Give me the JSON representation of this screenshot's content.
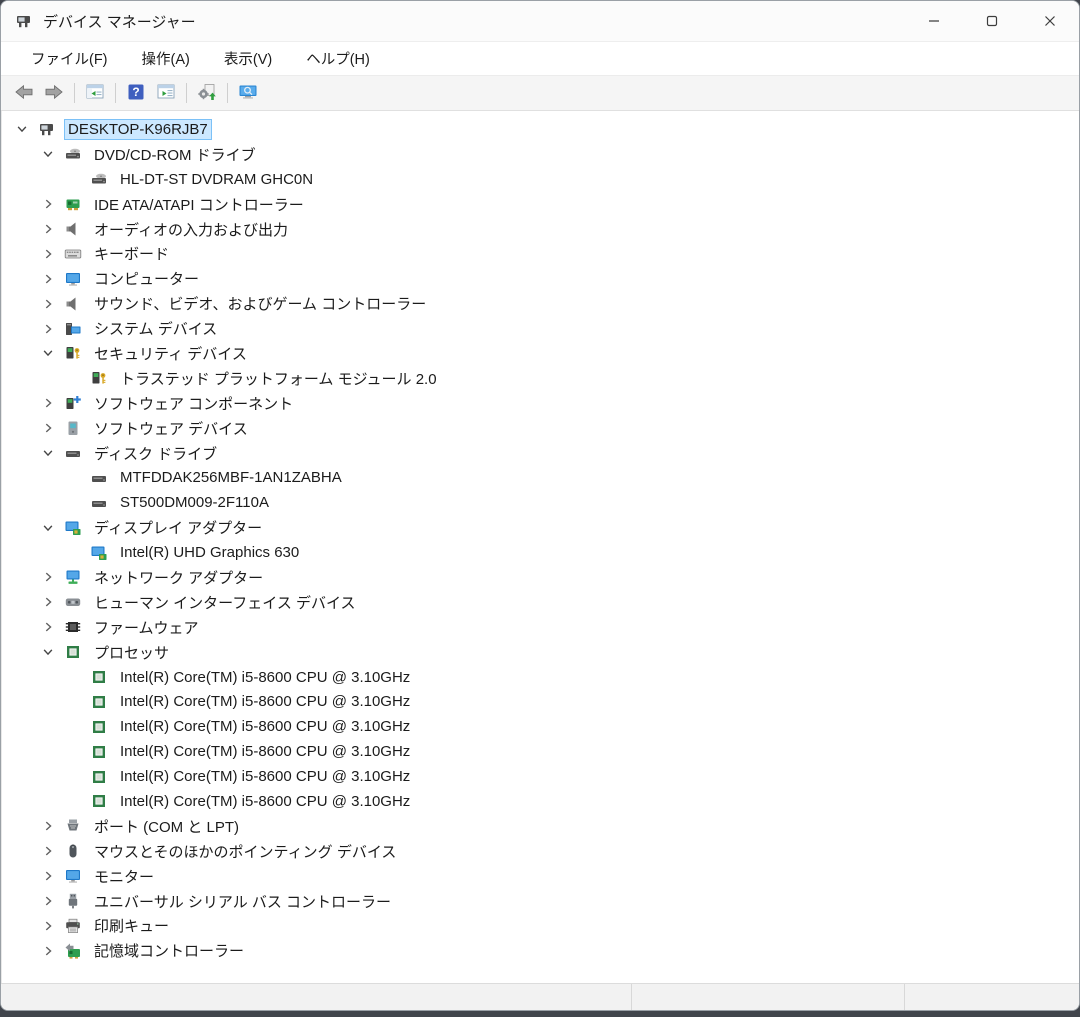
{
  "window": {
    "title": "デバイス マネージャー",
    "app_icon": "device-manager"
  },
  "menu": {
    "items": [
      {
        "label": "ファイル(F)"
      },
      {
        "label": "操作(A)"
      },
      {
        "label": "表示(V)"
      },
      {
        "label": "ヘルプ(H)"
      }
    ]
  },
  "toolbar": {
    "buttons": [
      {
        "name": "back",
        "icon": "nav-back"
      },
      {
        "name": "forward",
        "icon": "nav-forward"
      },
      {
        "divider": true
      },
      {
        "name": "show-console-tree",
        "icon": "window-panel-left"
      },
      {
        "divider": true
      },
      {
        "name": "help",
        "icon": "help"
      },
      {
        "name": "properties",
        "icon": "window-panel-right"
      },
      {
        "divider": true
      },
      {
        "name": "scan-hardware-changes",
        "icon": "scan-gear"
      },
      {
        "divider": true
      },
      {
        "name": "remote-computer",
        "icon": "monitor-search"
      }
    ]
  },
  "tree": {
    "items": [
      {
        "level": 0,
        "state": "expanded",
        "icon": "computer",
        "label": "DESKTOP-K96RJB7",
        "selected": true
      },
      {
        "level": 1,
        "state": "expanded",
        "icon": "cd-drive",
        "label": "DVD/CD-ROM ドライブ"
      },
      {
        "level": 2,
        "state": "none",
        "icon": "cd-drive",
        "label": "HL-DT-ST DVDRAM GHC0N"
      },
      {
        "level": 1,
        "state": "collapsed",
        "icon": "ide-controller",
        "label": "IDE ATA/ATAPI コントローラー"
      },
      {
        "level": 1,
        "state": "collapsed",
        "icon": "audio",
        "label": "オーディオの入力および出力"
      },
      {
        "level": 1,
        "state": "collapsed",
        "icon": "keyboard",
        "label": "キーボード"
      },
      {
        "level": 1,
        "state": "collapsed",
        "icon": "monitor-blue",
        "label": "コンピューター"
      },
      {
        "level": 1,
        "state": "collapsed",
        "icon": "audio",
        "label": "サウンド、ビデオ、およびゲーム コントローラー"
      },
      {
        "level": 1,
        "state": "collapsed",
        "icon": "system-device",
        "label": "システム デバイス"
      },
      {
        "level": 1,
        "state": "expanded",
        "icon": "security-device",
        "label": "セキュリティ デバイス"
      },
      {
        "level": 2,
        "state": "none",
        "icon": "security-device",
        "label": "トラステッド プラットフォーム モジュール 2.0"
      },
      {
        "level": 1,
        "state": "collapsed",
        "icon": "software-component",
        "label": "ソフトウェア コンポーネント"
      },
      {
        "level": 1,
        "state": "collapsed",
        "icon": "software-device",
        "label": "ソフトウェア デバイス"
      },
      {
        "level": 1,
        "state": "expanded",
        "icon": "disk-drive",
        "label": "ディスク ドライブ"
      },
      {
        "level": 2,
        "state": "none",
        "icon": "disk-drive",
        "label": "MTFDDAK256MBF-1AN1ZABHA"
      },
      {
        "level": 2,
        "state": "none",
        "icon": "disk-drive",
        "label": "ST500DM009-2F110A"
      },
      {
        "level": 1,
        "state": "expanded",
        "icon": "display-adapter",
        "label": "ディスプレイ アダプター"
      },
      {
        "level": 2,
        "state": "none",
        "icon": "display-adapter",
        "label": "Intel(R) UHD Graphics 630"
      },
      {
        "level": 1,
        "state": "collapsed",
        "icon": "network-adapter",
        "label": "ネットワーク アダプター"
      },
      {
        "level": 1,
        "state": "collapsed",
        "icon": "hid-device",
        "label": "ヒューマン インターフェイス デバイス"
      },
      {
        "level": 1,
        "state": "collapsed",
        "icon": "firmware-chip",
        "label": "ファームウェア"
      },
      {
        "level": 1,
        "state": "expanded",
        "icon": "processor",
        "label": "プロセッサ"
      },
      {
        "level": 2,
        "state": "none",
        "icon": "processor",
        "label": "Intel(R) Core(TM) i5-8600 CPU @ 3.10GHz"
      },
      {
        "level": 2,
        "state": "none",
        "icon": "processor",
        "label": "Intel(R) Core(TM) i5-8600 CPU @ 3.10GHz"
      },
      {
        "level": 2,
        "state": "none",
        "icon": "processor",
        "label": "Intel(R) Core(TM) i5-8600 CPU @ 3.10GHz"
      },
      {
        "level": 2,
        "state": "none",
        "icon": "processor",
        "label": "Intel(R) Core(TM) i5-8600 CPU @ 3.10GHz"
      },
      {
        "level": 2,
        "state": "none",
        "icon": "processor",
        "label": "Intel(R) Core(TM) i5-8600 CPU @ 3.10GHz"
      },
      {
        "level": 2,
        "state": "none",
        "icon": "processor",
        "label": "Intel(R) Core(TM) i5-8600 CPU @ 3.10GHz"
      },
      {
        "level": 1,
        "state": "collapsed",
        "icon": "serial-port",
        "label": "ポート (COM と LPT)"
      },
      {
        "level": 1,
        "state": "collapsed",
        "icon": "mouse",
        "label": "マウスとそのほかのポインティング デバイス"
      },
      {
        "level": 1,
        "state": "collapsed",
        "icon": "monitor-blue",
        "label": "モニター"
      },
      {
        "level": 1,
        "state": "collapsed",
        "icon": "usb-plug",
        "label": "ユニバーサル シリアル バス コントローラー"
      },
      {
        "level": 1,
        "state": "collapsed",
        "icon": "printer",
        "label": "印刷キュー"
      },
      {
        "level": 1,
        "state": "collapsed",
        "icon": "storage-controller",
        "label": "記憶域コントローラー"
      }
    ]
  },
  "statusbar": {
    "cells": [
      "",
      "",
      ""
    ]
  },
  "colors": {
    "selection_fill": "#cce8ff",
    "selection_border": "#7cc1f7",
    "accent_green": "#2e9e4f",
    "accent_blue": "#2b86d2",
    "accent_gold": "#d9a927",
    "toolbar_bg": "#f5f5f5",
    "statusbar_bg": "#f2f2f2"
  }
}
